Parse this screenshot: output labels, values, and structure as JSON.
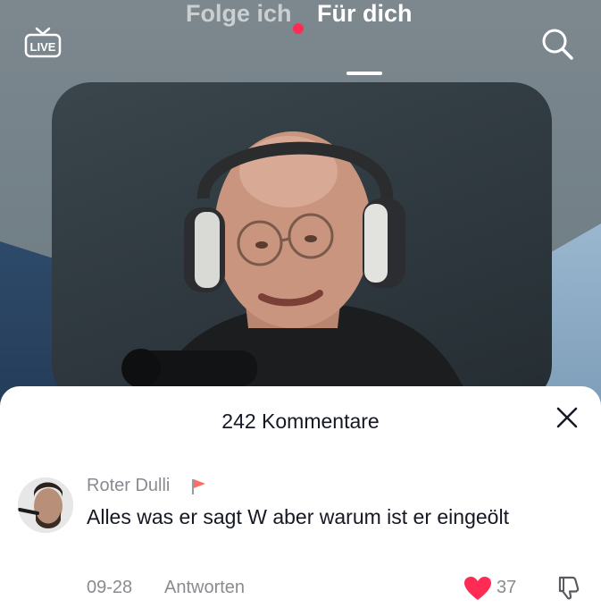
{
  "header": {
    "live_label": "LIVE",
    "tabs": [
      {
        "label": "Folge ich",
        "active": false,
        "has_notification": true
      },
      {
        "label": "Für dich",
        "active": true
      }
    ],
    "notification_color": "#fe2c55"
  },
  "comments_sheet": {
    "title": "242 Kommentare",
    "comments": [
      {
        "username": "Roter Dulli",
        "text": "Alles was er sagt W aber warum ist er eingeölt",
        "date": "09-28",
        "reply_label": "Antworten",
        "likes": "37",
        "liked": true
      }
    ]
  },
  "colors": {
    "like": "#fe2c55",
    "muted_text": "#8a8b91",
    "primary_text": "#161823"
  }
}
